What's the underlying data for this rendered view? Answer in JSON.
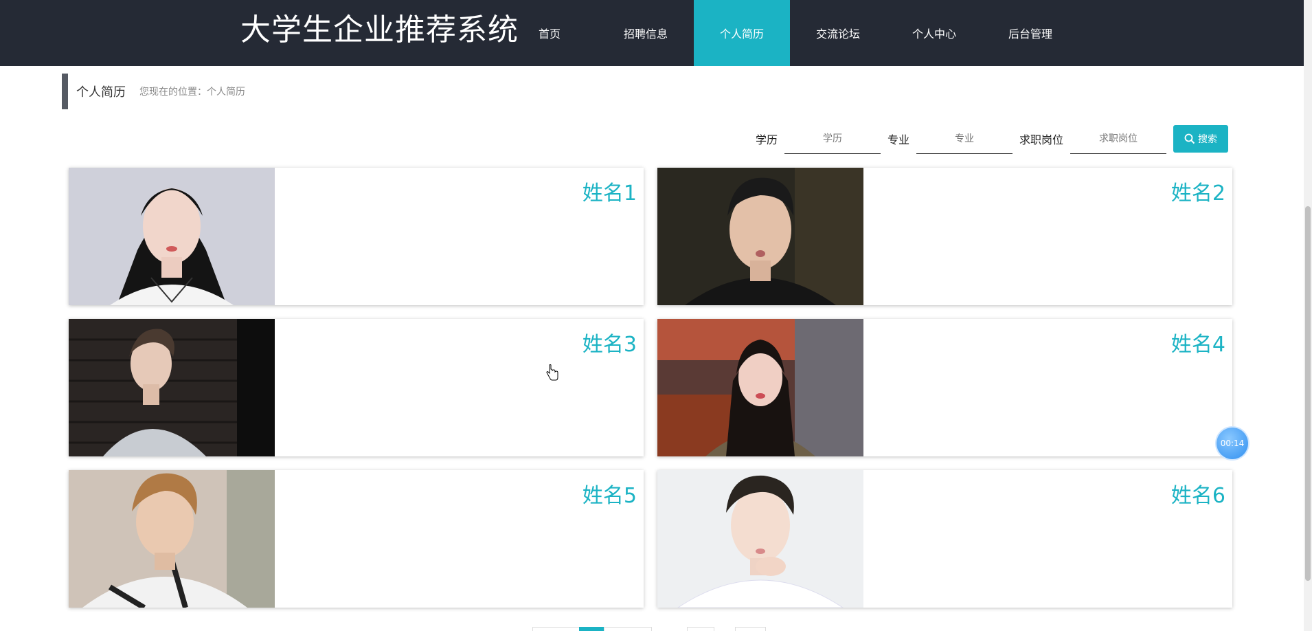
{
  "header": {
    "brand": "大学生企业推荐系统",
    "nav": [
      "首页",
      "招聘信息",
      "个人简历",
      "交流论坛",
      "个人中心",
      "后台管理"
    ],
    "active_nav": "个人简历"
  },
  "breadcrumb": {
    "title": "个人简历",
    "path": "您现在的位置：个人简历"
  },
  "search": {
    "education_label": "学历",
    "education_placeholder": "学历",
    "major_label": "专业",
    "major_placeholder": "专业",
    "position_label": "求职岗位",
    "position_placeholder": "求职岗位",
    "button_label": "搜索"
  },
  "cards": [
    {
      "name": "姓名1"
    },
    {
      "name": "姓名2"
    },
    {
      "name": "姓名3"
    },
    {
      "name": "姓名4"
    },
    {
      "name": "姓名5"
    },
    {
      "name": "姓名6"
    }
  ],
  "timer": "00:14",
  "colors": {
    "navbar": "#252a35",
    "accent": "#1bb3c4"
  }
}
